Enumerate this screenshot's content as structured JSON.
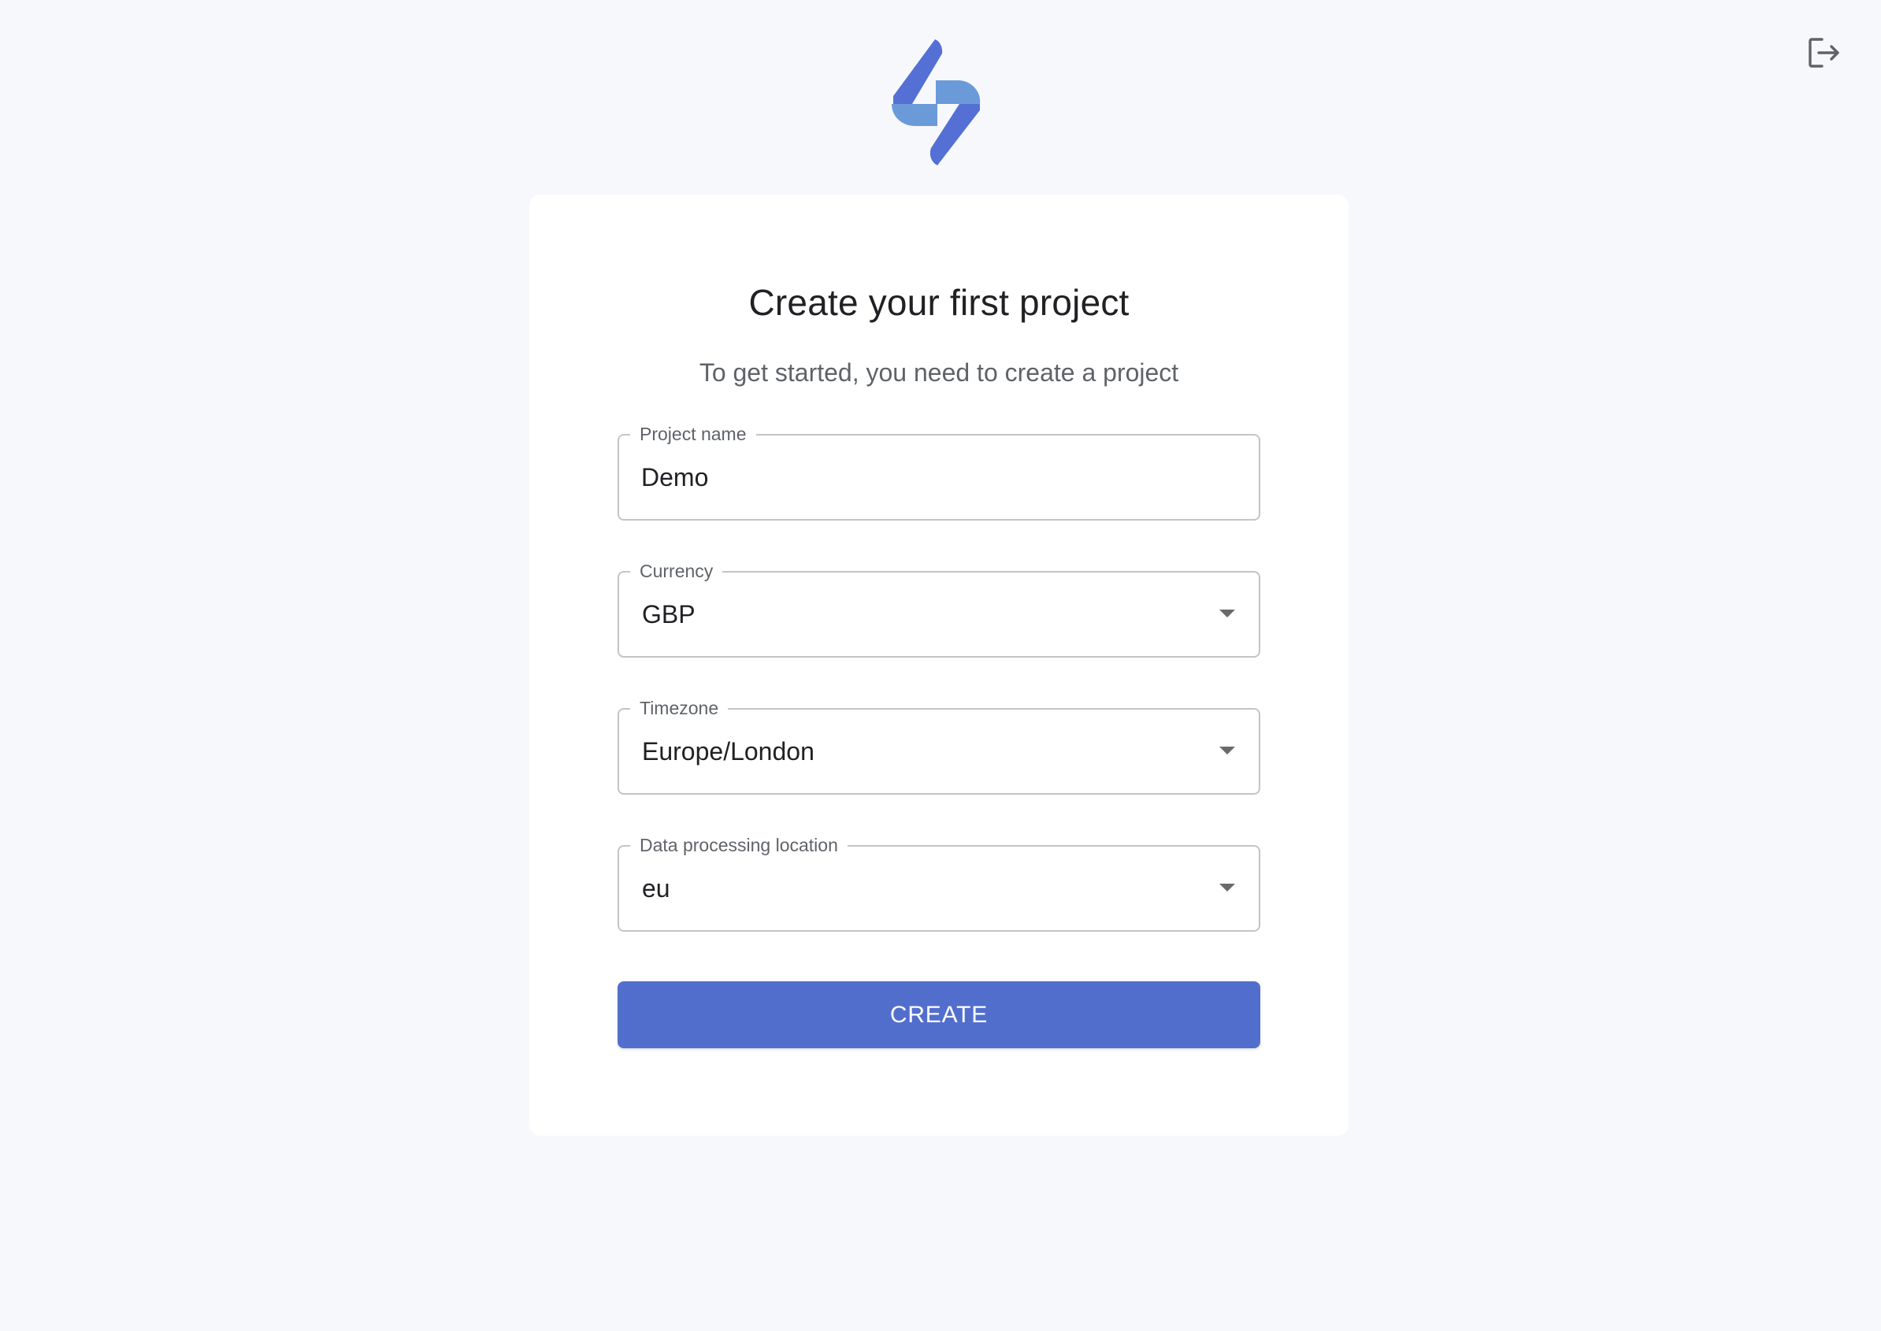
{
  "header": {
    "logo_icon": "brand-logo-icon",
    "logout_icon": "logout-icon"
  },
  "form": {
    "title": "Create your first project",
    "subtitle": "To get started, you need to create a project",
    "project_name": {
      "label": "Project name",
      "value": "Demo"
    },
    "currency": {
      "label": "Currency",
      "value": "GBP"
    },
    "timezone": {
      "label": "Timezone",
      "value": "Europe/London"
    },
    "data_location": {
      "label": "Data processing location",
      "value": "eu"
    },
    "create_label": "CREATE"
  },
  "colors": {
    "primary": "#526ecd",
    "logo_dark": "#5470d4",
    "logo_light": "#6a9bd8",
    "background": "#f7f8fb"
  }
}
